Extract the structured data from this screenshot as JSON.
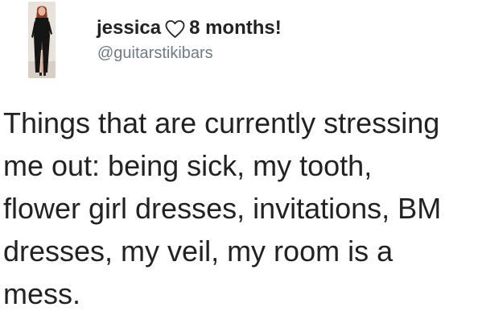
{
  "tweet": {
    "display_name": "jessica",
    "name_emoji_icon": "heart-outline-icon",
    "name_suffix": "8 months!",
    "handle": "@guitarstikibars",
    "text": "Things that are currently stressing\nme out: being sick, my tooth,\nflower girl dresses, invitations, BM\ndresses, my veil, my room is a\nmess."
  },
  "colors": {
    "text": "#222222",
    "handle": "#6f7b85",
    "background": "#ffffff"
  }
}
